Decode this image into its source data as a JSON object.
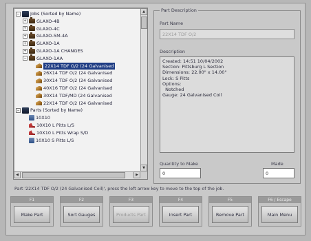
{
  "tree": {
    "items": [
      {
        "label": "Jobs (Sorted by Name)",
        "icon": "root-folder-icon",
        "expander": "−",
        "indent": 0
      },
      {
        "label": "GLAXO-4B",
        "icon": "folder-icon",
        "expander": "+",
        "indent": 1
      },
      {
        "label": "GLAXO-4C",
        "icon": "folder-icon",
        "expander": "+",
        "indent": 1
      },
      {
        "label": "GLAXO-5M-4A",
        "icon": "folder-icon",
        "expander": "+",
        "indent": 1
      },
      {
        "label": "GLAXO-1A",
        "icon": "folder-icon",
        "expander": "+",
        "indent": 1
      },
      {
        "label": "GLAXO-1A CHANGES",
        "icon": "folder-icon",
        "expander": "+",
        "indent": 1
      },
      {
        "label": "GLAXO-1AA",
        "icon": "folder-icon",
        "expander": "−",
        "indent": 1
      },
      {
        "label": "22X14 TDF O/2 (24 Galvanised",
        "icon": "part-icon",
        "expander": "",
        "indent": 2,
        "selected": true
      },
      {
        "label": "26X14 TDF O/2 (24 Galvanised",
        "icon": "part-icon",
        "expander": "",
        "indent": 2
      },
      {
        "label": "30X14 TDF O/2 (24 Galvanised",
        "icon": "part-icon",
        "expander": "",
        "indent": 2
      },
      {
        "label": "40X16 TDF O/2 (24 Galvanised",
        "icon": "part-icon",
        "expander": "",
        "indent": 2
      },
      {
        "label": "30X14 TDF/MD (24 Galvanised",
        "icon": "part-icon",
        "expander": "",
        "indent": 2
      },
      {
        "label": "22X14 TDF O/2 (24 Galvanised",
        "icon": "part-icon",
        "expander": "",
        "indent": 2
      },
      {
        "label": "Parts (Sorted by Name)",
        "icon": "root-folder-icon",
        "expander": "−",
        "indent": 0
      },
      {
        "label": "10X10",
        "icon": "blue-part-icon",
        "expander": "",
        "indent": 1
      },
      {
        "label": "10X10 L Pitts L/S",
        "icon": "red-part-icon",
        "expander": "",
        "indent": 1
      },
      {
        "label": "10X10 L Pitts Wrap S/D",
        "icon": "red-part-icon",
        "expander": "",
        "indent": 1
      },
      {
        "label": "10X10 S Pitts L/S",
        "icon": "blue-part-icon",
        "expander": "",
        "indent": 1
      }
    ]
  },
  "description": {
    "group_title": "Part Description",
    "part_name_label": "Part Name",
    "part_name_value": "22X14 TDF O/2",
    "description_label": "Description",
    "description_lines": [
      "Created: 14:51 10/04/2002",
      "Section: Pittsburg L Section",
      "Dimensions: 22.00\" x 14.00\"",
      "Lock: S Pitts",
      "Options:",
      "  Notched",
      "Gauge: 24 Galvanised Coil"
    ],
    "qty_label": "Quantity to Make",
    "qty_value": "0",
    "made_label": "Made",
    "made_value": "0"
  },
  "status": "Part '22X14 TDF O/2 (24 Galvanised Coil)', press the left arrow key to move to the top of the job.",
  "fkeys": [
    {
      "key": "F1",
      "label": "Make Part",
      "enabled": true
    },
    {
      "key": "F2",
      "label": "Sort Gauges",
      "enabled": true
    },
    {
      "key": "F3",
      "label": "Products Part",
      "enabled": false
    },
    {
      "key": "F4",
      "label": "Insert Part",
      "enabled": true
    },
    {
      "key": "F5",
      "label": "Remove Part",
      "enabled": true
    },
    {
      "key": "F6 / Escape",
      "label": "Main Menu",
      "enabled": true
    }
  ]
}
